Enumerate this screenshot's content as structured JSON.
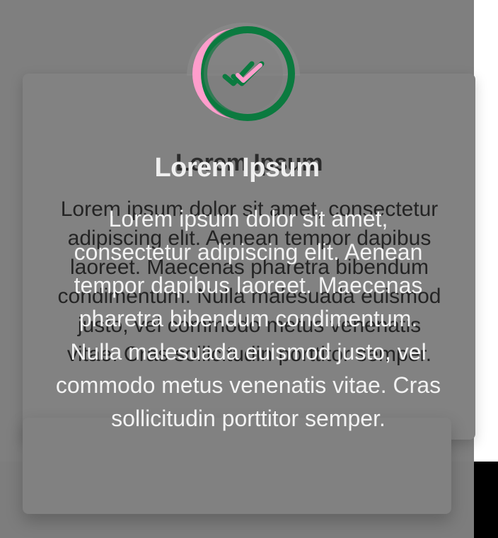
{
  "dialog_back": {
    "title": "Lorem Ipsum",
    "body": "Lorem ipsum dolor sit amet, consectetur adipiscing elit. Aenean tempor dapibus laoreet. Maecenas pharetra bibendum condimentum. Nulla malesuada euismod justo, vel commodo metus venenatis vitae. Cras sollicitudin porttitor semper."
  },
  "dialog_front": {
    "title": "Lorem Ipsum",
    "body": "Lorem ipsum dolor sit amet, consectetur adipiscing elit. Aenean tempor dapibus laoreet. Maecenas pharetra bibendum condimentum. Nulla malesuada euismod justo, vel commodo metus venenatis vitae. Cras sollicitudin porttitor semper."
  },
  "icon": {
    "name": "double-check-icon",
    "colors": {
      "green": "#0b7a3f",
      "pink": "#ff9dcc",
      "ring": "#8c8c8c"
    }
  }
}
